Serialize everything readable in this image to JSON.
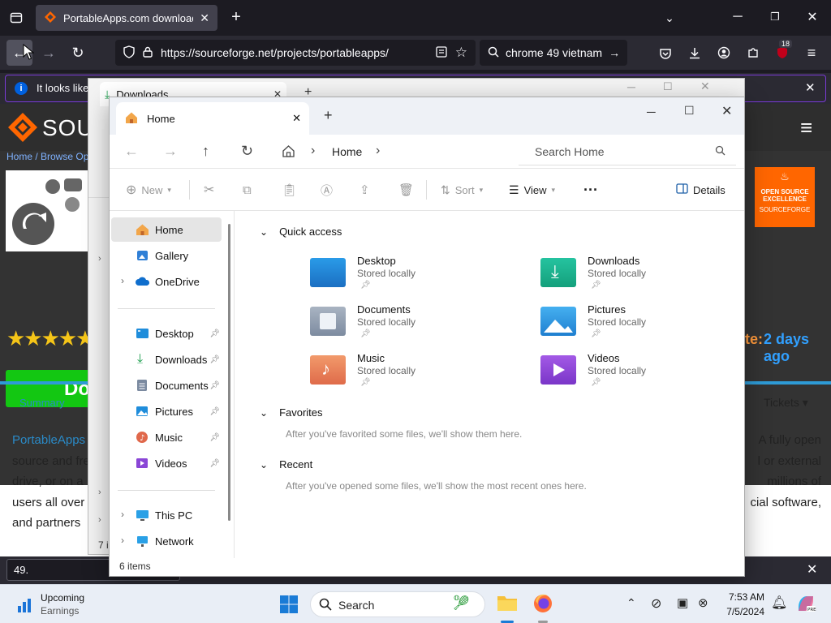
{
  "browser": {
    "tab_title": "PortableApps.com download |",
    "url": "https://sourceforge.net/projects/portableapps/",
    "search_text": "chrome 49 vietnam",
    "notification_text": "It looks like",
    "notif_badge": "18",
    "find_value": "49."
  },
  "website": {
    "logo_text": "SOUR",
    "breadcrumb": "Home / Browse Op",
    "rating_stars": "★★★★★",
    "update_label": "te:",
    "update_value": "2 days ago",
    "download_button": "Do",
    "summary_tab": "Summary",
    "tickets_tab": "Tickets ▾",
    "badge_line1": "OPEN SOURCE",
    "badge_line2": "EXCELLENCE",
    "badge_brand": "SOURCEFORGE",
    "desc_left": [
      "PortableApps",
      "source and fre",
      "drive, or on a",
      "users all over",
      "and partners"
    ],
    "desc_right": [
      "A fully open",
      "l or external",
      "millions of",
      "cial software,"
    ]
  },
  "back_window": {
    "tab_title": "Downloads",
    "side_count": "7 i"
  },
  "explorer": {
    "tab_title": "Home",
    "breadcrumb": "Home",
    "search_placeholder": "Search Home",
    "toolbar": {
      "new": "New",
      "sort": "Sort",
      "view": "View",
      "details": "Details"
    },
    "sidebar": {
      "home": "Home",
      "gallery": "Gallery",
      "onedrive": "OneDrive",
      "desktop": "Desktop",
      "downloads": "Downloads",
      "documents": "Documents",
      "pictures": "Pictures",
      "music": "Music",
      "videos": "Videos",
      "thispc": "This PC",
      "network": "Network"
    },
    "quick_access_title": "Quick access",
    "quick_access": [
      {
        "name": "Desktop",
        "status": "Stored locally"
      },
      {
        "name": "Downloads",
        "status": "Stored locally"
      },
      {
        "name": "Documents",
        "status": "Stored locally"
      },
      {
        "name": "Pictures",
        "status": "Stored locally"
      },
      {
        "name": "Music",
        "status": "Stored locally"
      },
      {
        "name": "Videos",
        "status": "Stored locally"
      }
    ],
    "favorites_title": "Favorites",
    "favorites_note": "After you've favorited some files, we'll show them here.",
    "recent_title": "Recent",
    "recent_note": "After you've opened some files, we'll show the most recent ones here.",
    "status": "6 items"
  },
  "taskbar": {
    "weather_title": "Upcoming",
    "weather_sub": "Earnings",
    "search": "Search",
    "time": "7:53 AM",
    "date": "7/5/2024"
  }
}
